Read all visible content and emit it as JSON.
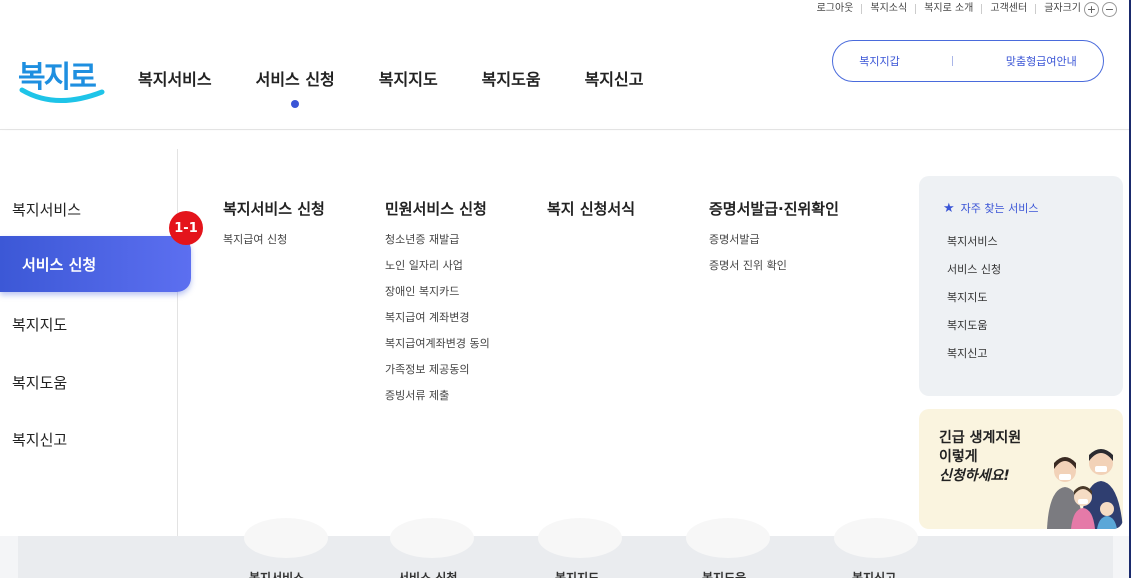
{
  "utility_bar": {
    "links": [
      "로그아웃",
      "복지소식",
      "복지로 소개",
      "고객센터"
    ],
    "font_size_label": "글자크기",
    "increase": "+",
    "decrease": "−"
  },
  "logo": {
    "text": "복지로"
  },
  "gnb": {
    "items": [
      "복지서비스",
      "서비스 신청",
      "복지지도",
      "복지도움",
      "복지신고"
    ],
    "active_index": 1
  },
  "pill": {
    "left_label": "복지지갑",
    "right_label": "맞춤형급여안내"
  },
  "left_nav": {
    "items": [
      "복지서비스",
      "서비스 신청",
      "복지지도",
      "복지도움",
      "복지신고"
    ],
    "active_index": 1
  },
  "badge": {
    "label": "1-1"
  },
  "columns": [
    {
      "title": "복지서비스 신청",
      "items": [
        "복지급여 신청"
      ]
    },
    {
      "title": "민원서비스 신청",
      "items": [
        "청소년증 재발급",
        "노인 일자리 사업",
        "장애인 복지카드",
        "복지급여 계좌변경",
        "복지급여계좌변경 동의",
        "가족정보 제공동의",
        "증빙서류 제출"
      ]
    },
    {
      "title": "복지 신청서식",
      "items": []
    },
    {
      "title": "증명서발급·진위확인",
      "items": [
        "증명서발급",
        "증명서 진위 확인"
      ]
    }
  ],
  "favorites": {
    "title": "자주 찾는 서비스",
    "items": [
      "복지서비스",
      "서비스 신청",
      "복지지도",
      "복지도움",
      "복지신고"
    ]
  },
  "promo": {
    "line1": "긴급 생계지원",
    "line2": "이렇게",
    "line3": "신청하세요!"
  },
  "bottom_tabs": [
    "복지서비스",
    "서비스 신청",
    "복지지도",
    "복지도움",
    "복지신고"
  ],
  "colors": {
    "accent": "#3a55d6",
    "badge": "#e4141b",
    "logo": "#1e8fe0",
    "promo_bg": "#faf4df",
    "fav_bg": "#eef1f4"
  }
}
